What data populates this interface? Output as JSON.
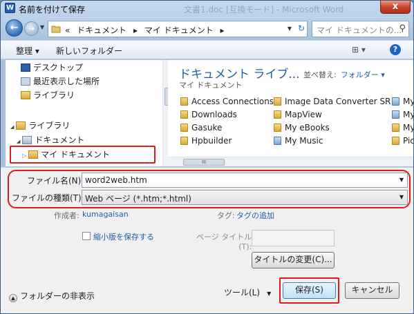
{
  "window": {
    "title": "名前を付けて保存",
    "app_icon_letter": "W",
    "background_title": "文書1.doc [互換モード] - Microsoft Word",
    "close_label": "x"
  },
  "address": {
    "crumbs": [
      "«",
      "ドキュメント",
      "▸",
      "マイ ドキュメント",
      "▸"
    ],
    "search_placeholder": "マイ ドキュメントの...",
    "search_icon": "search-icon"
  },
  "toolbar": {
    "organize_label": "整理 ▾",
    "new_folder_label": "新しいフォルダー",
    "view_label": "⊞ ▾",
    "help_label": "?"
  },
  "nav_pane": {
    "items": [
      {
        "label": "デスクトップ",
        "icon": "desktop-icon"
      },
      {
        "label": "最近表示した場所",
        "icon": "recent-places-icon"
      },
      {
        "label": "ライブラリ",
        "icon": "library-icon"
      },
      {
        "label": "ライブラリ",
        "icon": "library-icon",
        "expander": "◢"
      },
      {
        "label": "ドキュメント",
        "icon": "documents-icon",
        "expander": "◢"
      },
      {
        "label": "マイ ドキュメント",
        "icon": "folder-icon",
        "expander": "▷"
      }
    ]
  },
  "content": {
    "library_title": "ドキュメント ライブ...",
    "library_subtitle": "マイ ドキュメント",
    "arrange_label": "並べ替え:",
    "arrange_value": "フォルダー ▾",
    "files": [
      {
        "name": "Access Connections",
        "kind": "folder"
      },
      {
        "name": "Downloads",
        "kind": "folder"
      },
      {
        "name": "Gasuke",
        "kind": "folder"
      },
      {
        "name": "Hpbuilder",
        "kind": "folder"
      },
      {
        "name": "Image Data Converter SR",
        "kind": "folder"
      },
      {
        "name": "MapView",
        "kind": "folder"
      },
      {
        "name": "My eBooks",
        "kind": "folder"
      },
      {
        "name": "My Music",
        "kind": "music"
      },
      {
        "name": "My",
        "kind": "special"
      },
      {
        "name": "My",
        "kind": "special"
      },
      {
        "name": "My",
        "kind": "folder"
      },
      {
        "name": "Pic",
        "kind": "folder"
      }
    ],
    "hscroll_thumb_label": "III"
  },
  "form": {
    "filename_label": "ファイル名(N):",
    "filename_value": "word2web.htm",
    "filetype_label": "ファイルの種類(T):",
    "filetype_value": "Web ページ (*.htm;*.html)",
    "author_label": "作成者:",
    "author_value": "kumagaisan",
    "tags_label": "タグ:",
    "tags_value": "タグの追加",
    "thumbnail_label": "縮小版を保存する",
    "page_title_label_line1": "ページ タイトル",
    "page_title_label_line2": "(T):",
    "change_title_label": "タイトルの変更(C)...",
    "hide_folders_label": "フォルダーの非表示",
    "tools_label": "ツール(L)",
    "save_label": "保存(S)",
    "cancel_label": "キャンセル"
  }
}
